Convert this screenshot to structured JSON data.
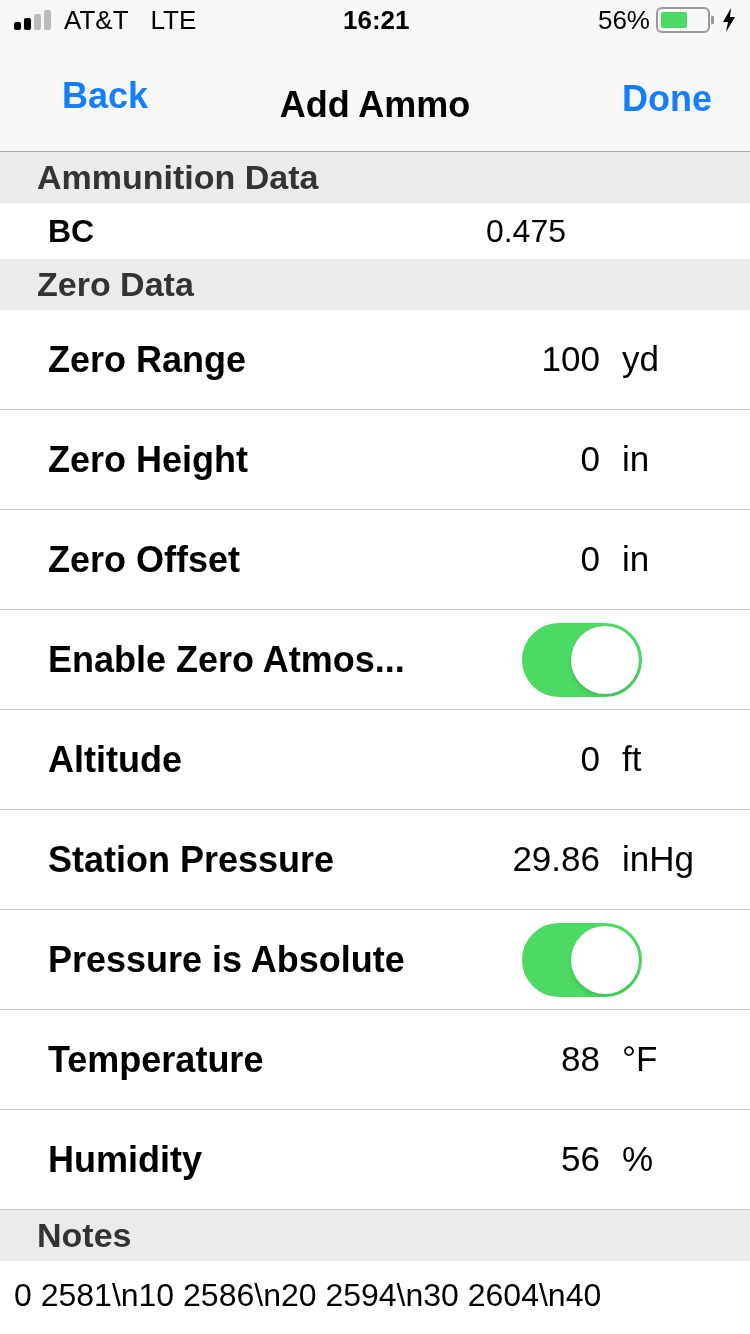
{
  "status_bar": {
    "carrier": "AT&T",
    "network": "LTE",
    "time": "16:21",
    "battery_percent": "56%"
  },
  "nav_bar": {
    "back": "Back",
    "title": "Add Ammo",
    "done": "Done"
  },
  "sections": [
    {
      "header": "Ammunition Data",
      "rows": [
        {
          "kind": "compact",
          "label": "BC",
          "value": "0.475"
        }
      ]
    },
    {
      "header": "Zero Data",
      "rows": [
        {
          "kind": "value",
          "label": "Zero Range",
          "value": "100",
          "unit": "yd"
        },
        {
          "kind": "value",
          "label": "Zero Height",
          "value": "0",
          "unit": "in"
        },
        {
          "kind": "value",
          "label": "Zero Offset",
          "value": "0",
          "unit": "in"
        },
        {
          "kind": "toggle",
          "label": "Enable Zero Atmos...",
          "on": true
        },
        {
          "kind": "value",
          "label": "Altitude",
          "value": "0",
          "unit": "ft"
        },
        {
          "kind": "value",
          "label": "Station Pressure",
          "value": "29.86",
          "unit": "inHg"
        },
        {
          "kind": "toggle",
          "label": "Pressure is Absolute",
          "on": true
        },
        {
          "kind": "value",
          "label": "Temperature",
          "value": "88",
          "unit": "°F"
        },
        {
          "kind": "value",
          "label": "Humidity",
          "value": "56",
          "unit": "%"
        }
      ]
    },
    {
      "header": "Notes",
      "rows": [
        {
          "kind": "note",
          "text": "0 2581\\n10 2586\\n20 2594\\n30 2604\\n40"
        }
      ]
    }
  ]
}
